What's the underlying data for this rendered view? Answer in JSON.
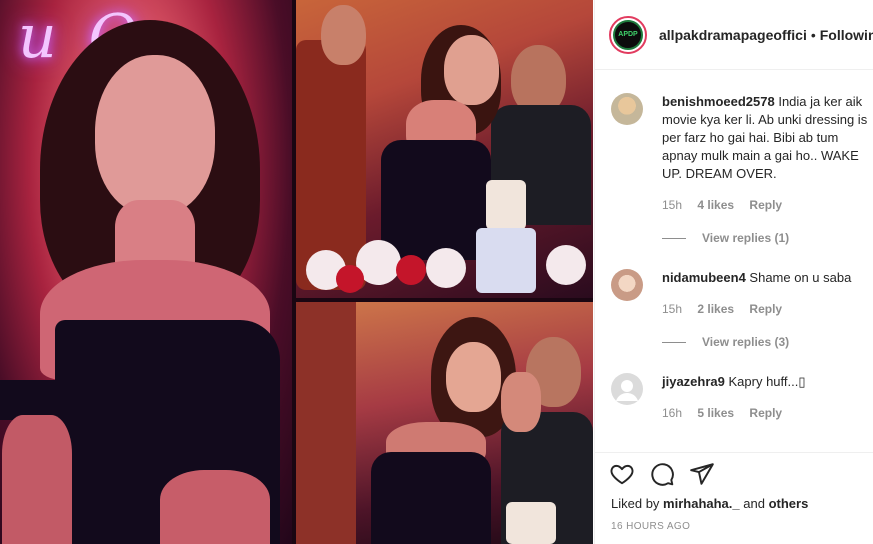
{
  "post": {
    "username": "allpakdramapageoffici",
    "separator": "•",
    "follow_status": "Following",
    "avatar_text": "APDP"
  },
  "photo": {
    "neon_sign": "u Q"
  },
  "comments": [
    {
      "username": "benishmoeed2578",
      "text": "India ja ker aik movie kya ker li. Ab unki dressing is per farz ho gai hai. Bibi ab tum apnay mulk main a gai ho.. WAKE UP. DREAM OVER.",
      "time": "15h",
      "likes": "4 likes",
      "reply": "Reply",
      "view_replies": "View replies (1)"
    },
    {
      "username": "nidamubeen4",
      "text": "Shame on u saba",
      "time": "15h",
      "likes": "2 likes",
      "reply": "Reply",
      "view_replies": "View replies (3)"
    },
    {
      "username": "jiyazehra9",
      "text": "Kapry huff...▯",
      "time": "16h",
      "likes": "5 likes",
      "reply": "Reply"
    }
  ],
  "footer": {
    "liked_by_prefix": "Liked by",
    "liked_by_user": "mirhahaha._",
    "liked_by_suffix": "and",
    "liked_by_others": "others",
    "time_ago": "16 HOURS AGO"
  },
  "colors": {
    "story_ring": "#e23b5f",
    "text_primary": "#262626",
    "text_secondary": "#8e8e8e"
  }
}
